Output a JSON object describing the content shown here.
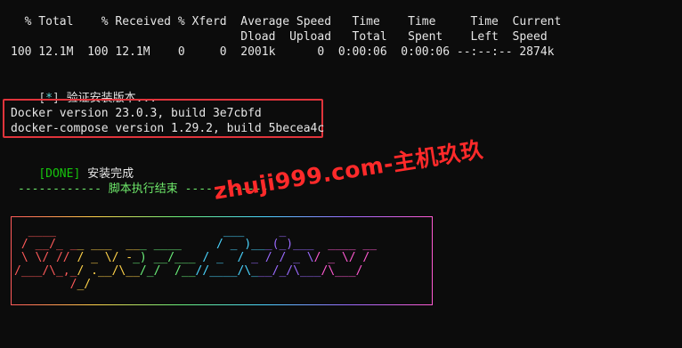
{
  "progress_header": {
    "line1": "  % Total    % Received % Xferd  Average Speed   Time    Time     Time  Current",
    "line2": "                                 Dload  Upload   Total   Spent    Left  Speed",
    "line3": "100 12.1M  100 12.1M    0     0  2001k      0  0:00:06  0:00:06 --:--:-- 2874k"
  },
  "verify_step": {
    "bracket_open": "[",
    "marker": "*",
    "bracket_close": "]",
    "text": " 验证安装版本..."
  },
  "versions": {
    "docker": "Docker version 23.0.3, build 3e7cbfd",
    "compose": "docker-compose version 1.29.2, build 5becea4c"
  },
  "done_step": {
    "tag": "[DONE]",
    "text": " 安装完成"
  },
  "footer_line": "------------ 脚本执行结束 ------------",
  "watermark": "zhuji999.com-主机玖玖",
  "banner": {
    "brand": "SuperBot",
    "rows": [
      "  ____                        ___     _              ",
      " / __/_ __ ___  ___ ____     / _ )___(_)___  ____ __ ",
      " \\ \\/ // / _ \\/ -_) __/___ / _  / _ / / _ \\/ _ \\/ /",
      "/___/\\_,_/ .__/\\__/_/  /__//____/\\___/_/\\___/\\___/  ",
      "        /_/                                          "
    ],
    "colors": [
      "#ff5a5a",
      "#ffd24a",
      "#6af07a",
      "#4ad5ff",
      "#9b6bff",
      "#ff5ad2"
    ]
  }
}
